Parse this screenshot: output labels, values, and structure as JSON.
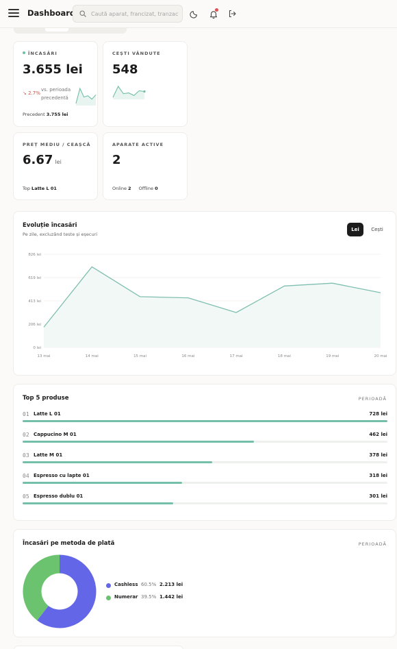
{
  "header": {
    "title": "Dashboard",
    "search_placeholder": "Caută aparat, francizat, tranzacție",
    "icons": [
      "menu-icon",
      "search-icon",
      "moon-icon",
      "bell-icon",
      "logout-icon"
    ]
  },
  "kpis": {
    "revenue": {
      "label": "ÎNCASĂRI",
      "value": "3.655 lei",
      "delta": "↘ 2.7%",
      "delta_note": "vs. perioada precedentă",
      "prev_label": "Precedent",
      "prev_value": "3.755 lei",
      "spark": [
        40,
        75,
        55,
        58,
        50,
        60
      ]
    },
    "cups": {
      "label": "CEȘTI VÂNDUTE",
      "value": "548",
      "spark": [
        50,
        80,
        60,
        62,
        55,
        68,
        66
      ]
    },
    "avg_price": {
      "label": "PREȚ MEDIU / CEAȘCĂ",
      "value": "6.67",
      "unit": "lei",
      "top_label": "Top",
      "top_value": "Latte L 01"
    },
    "machines": {
      "label": "APARATE ACTIVE",
      "value": "2",
      "online_label": "Online",
      "online_value": "2",
      "offline_label": "Offline",
      "offline_value": "0"
    }
  },
  "revenue_chart": {
    "title": "Evoluție încasări",
    "subtitle": "Pe zile, excluzând teste și eșecuri",
    "toggle_lei": "Lei",
    "toggle_cesti": "Cești"
  },
  "chart_data": {
    "type": "area",
    "x": [
      "13 mai",
      "14 mai",
      "15 mai",
      "16 mai",
      "17 mai",
      "18 mai",
      "19 mai",
      "20 mai"
    ],
    "series": [
      {
        "values": [
          180,
          715,
          450,
          440,
          310,
          545,
          570,
          485
        ]
      }
    ],
    "ylim": [
      0,
      826
    ],
    "yticks": [
      0,
      206,
      413,
      619,
      826
    ],
    "ytick_labels": [
      "0 lei",
      "206 lei",
      "413 lei",
      "619 lei",
      "826 lei"
    ],
    "grid": true,
    "color": "#7fbfb0"
  },
  "top_products": {
    "title": "Top 5 produse",
    "period": "PERIOADĂ",
    "max": 728,
    "items": [
      {
        "rank": "01",
        "name": "Latte L 01",
        "value": 728,
        "value_label": "728 lei"
      },
      {
        "rank": "02",
        "name": "Cappucino M 01",
        "value": 462,
        "value_label": "462 lei"
      },
      {
        "rank": "03",
        "name": "Latte M 01",
        "value": 378,
        "value_label": "378 lei"
      },
      {
        "rank": "04",
        "name": "Espresso cu lapte 01",
        "value": 318,
        "value_label": "318 lei"
      },
      {
        "rank": "05",
        "name": "Espresso dublu 01",
        "value": 301,
        "value_label": "301 lei"
      }
    ]
  },
  "payment_methods": {
    "title": "Încasări pe metoda de plată",
    "period": "PERIOADĂ",
    "items": [
      {
        "name": "Cashless",
        "pct_label": "60.5%",
        "pct": 60.5,
        "value": "2.213 lei",
        "color": "#6466e8"
      },
      {
        "name": "Numerar",
        "pct_label": "39.5%",
        "pct": 39.5,
        "value": "1.442 lei",
        "color": "#6bc36f"
      }
    ]
  }
}
